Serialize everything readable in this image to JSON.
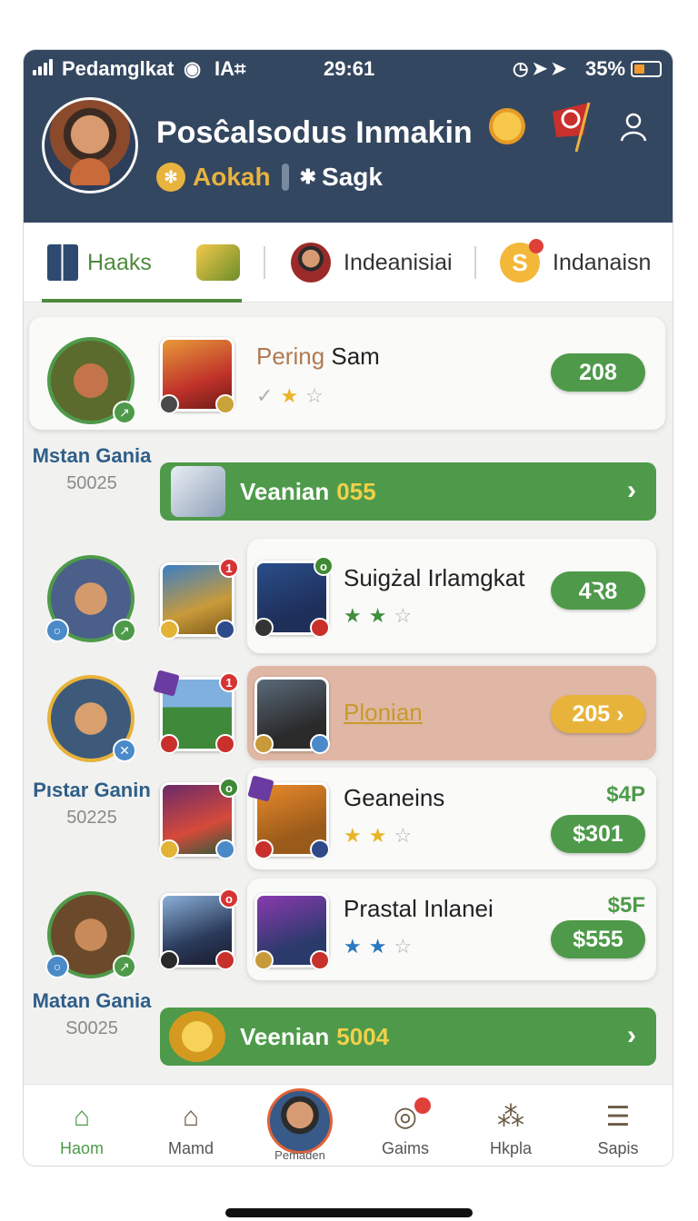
{
  "status_bar": {
    "carrier": "Pedamglkat",
    "network": "IA⌗",
    "time": "29:61",
    "icons": "◷➤➤",
    "battery_pct": "35%",
    "battery_level": 0.35
  },
  "profile": {
    "name": "Posĉalsodus Inmakin",
    "rank_gold_text": "Aokah",
    "rank_secondary": "Sagk",
    "rank_icon": "✱"
  },
  "tabs": [
    {
      "label": "Haaks",
      "active": true
    },
    {
      "label": "Indeanisiai"
    },
    {
      "label": "Indanaisn",
      "coin_glyph": "S"
    }
  ],
  "players": [
    {
      "name": "Mstan Gania",
      "id": "50025"
    },
    {
      "name": "Pıstar Ganin",
      "id": "50225"
    },
    {
      "name": "Matan Gania",
      "id": "S0025"
    }
  ],
  "cards": [
    {
      "title_muted": "Pering",
      "title": " Sam",
      "value": "208",
      "stars_filled": 1,
      "stars_total": 2
    },
    {
      "title": "Suigżal Irlamgkat",
      "value": "4Ꝛ8",
      "stars_filled": 2,
      "stars_total": 3
    },
    {
      "title": "Plonian",
      "value": "205 ›"
    },
    {
      "title": "Geaneins",
      "price": "$4P",
      "value": "$301",
      "stars_filled": 2,
      "stars_total": 3
    },
    {
      "title": "Prastal Inlanei",
      "price": "$5F",
      "value": "$555",
      "stars_filled": 2,
      "stars_total": 3
    }
  ],
  "banners": [
    {
      "label": "Veanian",
      "number": "055"
    },
    {
      "label": "Veenian",
      "number": "5004"
    }
  ],
  "thumb_badges": {
    "b1": "1",
    "b2": "ο",
    "b3": "1",
    "b4": "ο",
    "b5": "ο"
  },
  "bottom_nav": [
    {
      "label": "Haom",
      "icon": "home-icon",
      "active": true
    },
    {
      "label": "Mamd",
      "icon": "house-outline-icon"
    },
    {
      "label": "Pemaden",
      "icon": "avatar"
    },
    {
      "label": "Gaims",
      "icon": "game-icon"
    },
    {
      "label": "Hkpla",
      "icon": "help-icon"
    },
    {
      "label": "Sapis",
      "icon": "menu-icon"
    }
  ],
  "colors": {
    "header_bg": "#344760",
    "accent_green": "#4e9a4a",
    "gold": "#e8b33f",
    "highlight_card": "#dfb7a4"
  }
}
